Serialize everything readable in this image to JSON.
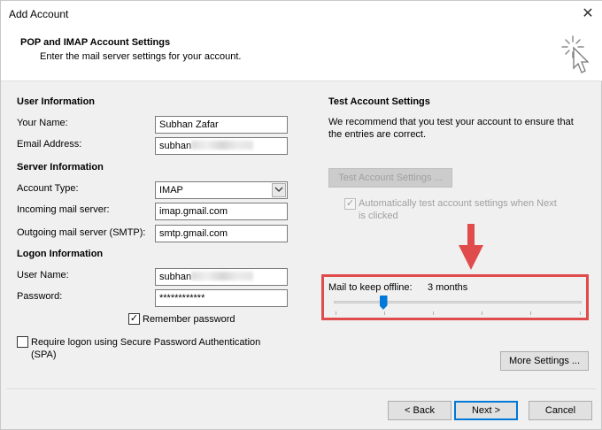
{
  "window": {
    "title": "Add Account"
  },
  "header": {
    "title": "POP and IMAP Account Settings",
    "subtitle": "Enter the mail server settings for your account."
  },
  "user_information": {
    "heading": "User Information",
    "your_name_label": "Your Name:",
    "your_name_value": "Subhan Zafar",
    "email_label": "Email Address:",
    "email_value": "subhan"
  },
  "server_information": {
    "heading": "Server Information",
    "account_type_label": "Account Type:",
    "account_type_value": "IMAP",
    "incoming_label": "Incoming mail server:",
    "incoming_value": "imap.gmail.com",
    "outgoing_label": "Outgoing mail server (SMTP):",
    "outgoing_value": "smtp.gmail.com"
  },
  "logon_information": {
    "heading": "Logon Information",
    "username_label": "User Name:",
    "username_value": "subhan",
    "password_label": "Password:",
    "password_value": "************",
    "remember_password_label": "Remember password",
    "remember_password_checked": true,
    "spa_label_line1": "Require logon using Secure Password Authentication",
    "spa_label_line2": "(SPA)",
    "spa_checked": false
  },
  "test_settings": {
    "heading": "Test Account Settings",
    "description_line1": "We recommend that you test your account to ensure that",
    "description_line2": "the entries are correct.",
    "test_button_label": "Test Account Settings ...",
    "auto_test_label_line1": "Automatically test account settings when Next",
    "auto_test_label_line2": "is clicked",
    "auto_test_checked": true
  },
  "offline": {
    "label": "Mail to keep offline:",
    "value": "3 months",
    "slider_position": 0.2
  },
  "more_settings_label": "More Settings ...",
  "footer": {
    "back_label": "< Back",
    "next_label": "Next >",
    "cancel_label": "Cancel"
  },
  "colors": {
    "accent": "#0078d7",
    "highlight_box": "#e04b4b",
    "annotation_arrow": "#e04b4b"
  },
  "icons": {
    "close": "close-icon",
    "wizard": "cursor-sparkle-icon",
    "dropdown": "chevron-down-icon",
    "annotation": "down-arrow-icon"
  }
}
